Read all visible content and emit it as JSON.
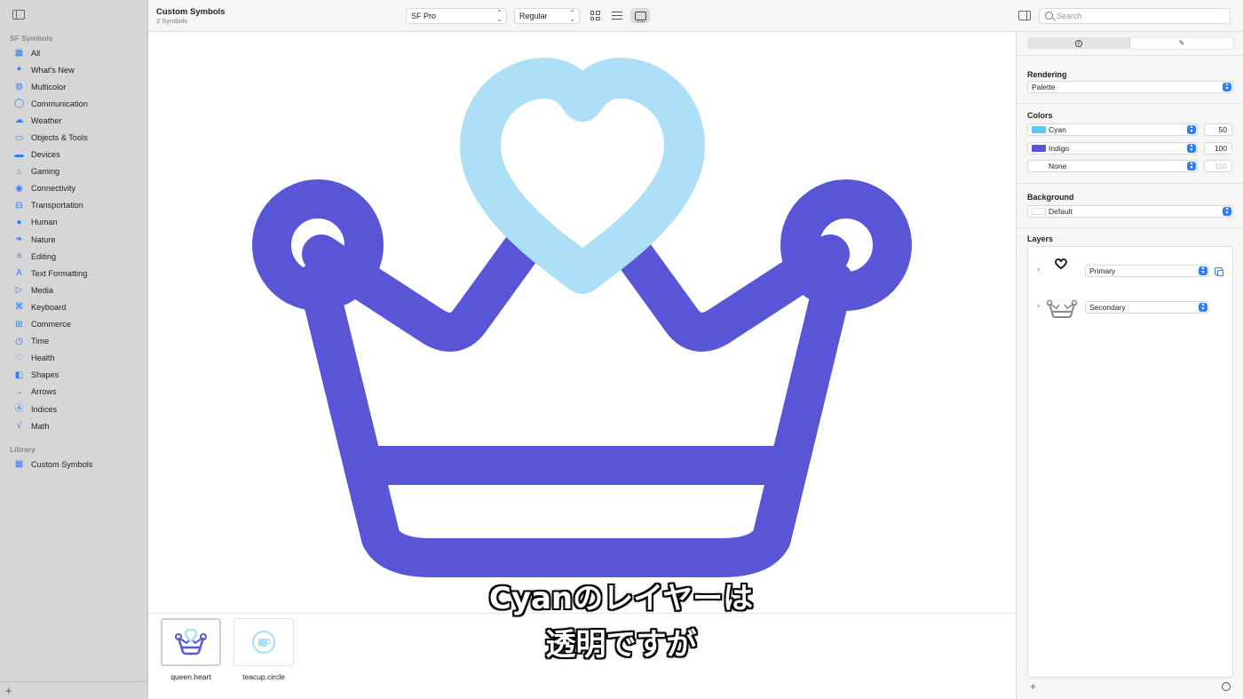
{
  "sidebar": {
    "section_sf": "SF Symbols",
    "items": [
      {
        "label": "All",
        "icon": "grid-icon"
      },
      {
        "label": "What's New",
        "icon": "sparkles-icon"
      },
      {
        "label": "Multicolor",
        "icon": "paintpalette-icon"
      },
      {
        "label": "Communication",
        "icon": "message-icon"
      },
      {
        "label": "Weather",
        "icon": "cloud-icon"
      },
      {
        "label": "Objects & Tools",
        "icon": "folder-icon"
      },
      {
        "label": "Devices",
        "icon": "desktop-icon"
      },
      {
        "label": "Gaming",
        "icon": "gamecontroller-icon"
      },
      {
        "label": "Connectivity",
        "icon": "antenna-icon"
      },
      {
        "label": "Transportation",
        "icon": "car-icon"
      },
      {
        "label": "Human",
        "icon": "person-icon"
      },
      {
        "label": "Nature",
        "icon": "leaf-icon"
      },
      {
        "label": "Editing",
        "icon": "slider-icon"
      },
      {
        "label": "Text Formatting",
        "icon": "textformat-icon"
      },
      {
        "label": "Media",
        "icon": "playpause-icon"
      },
      {
        "label": "Keyboard",
        "icon": "command-icon"
      },
      {
        "label": "Commerce",
        "icon": "cart-icon"
      },
      {
        "label": "Time",
        "icon": "clock-icon"
      },
      {
        "label": "Health",
        "icon": "heart-icon"
      },
      {
        "label": "Shapes",
        "icon": "square-circle-icon"
      },
      {
        "label": "Arrows",
        "icon": "arrow-right-icon"
      },
      {
        "label": "Indices",
        "icon": "a-circle-icon"
      },
      {
        "label": "Math",
        "icon": "sqrt-icon"
      }
    ],
    "section_library": "Library",
    "library_items": [
      {
        "label": "Custom Symbols",
        "icon": "grid-icon"
      }
    ]
  },
  "toolbar": {
    "title": "Custom Symbols",
    "subtitle": "2 Symbols",
    "font_value": "SF Pro",
    "weight_value": "Regular",
    "search_placeholder": "Search"
  },
  "preview": {
    "symbol": "queen.heart",
    "primary_color": "#ade0f6",
    "secondary_color": "#5856d6"
  },
  "gallery": [
    {
      "name": "queen.heart"
    },
    {
      "name": "teacup.circle"
    }
  ],
  "caption": {
    "line1": "Cyanのレイヤーは",
    "line2": "透明ですが"
  },
  "inspector": {
    "rendering_label": "Rendering",
    "rendering_value": "Palette",
    "colors_label": "Colors",
    "colors": [
      {
        "name": "Cyan",
        "swatch": "#5ac8fa",
        "value": "50"
      },
      {
        "name": "Indigo",
        "swatch": "#5856d6",
        "value": "100"
      },
      {
        "name": "None",
        "swatch": "",
        "value": "100"
      }
    ],
    "background_label": "Background",
    "background_value": "Default",
    "layers_label": "Layers",
    "layers": [
      {
        "value": "Primary"
      },
      {
        "value": "Secondary"
      }
    ]
  }
}
